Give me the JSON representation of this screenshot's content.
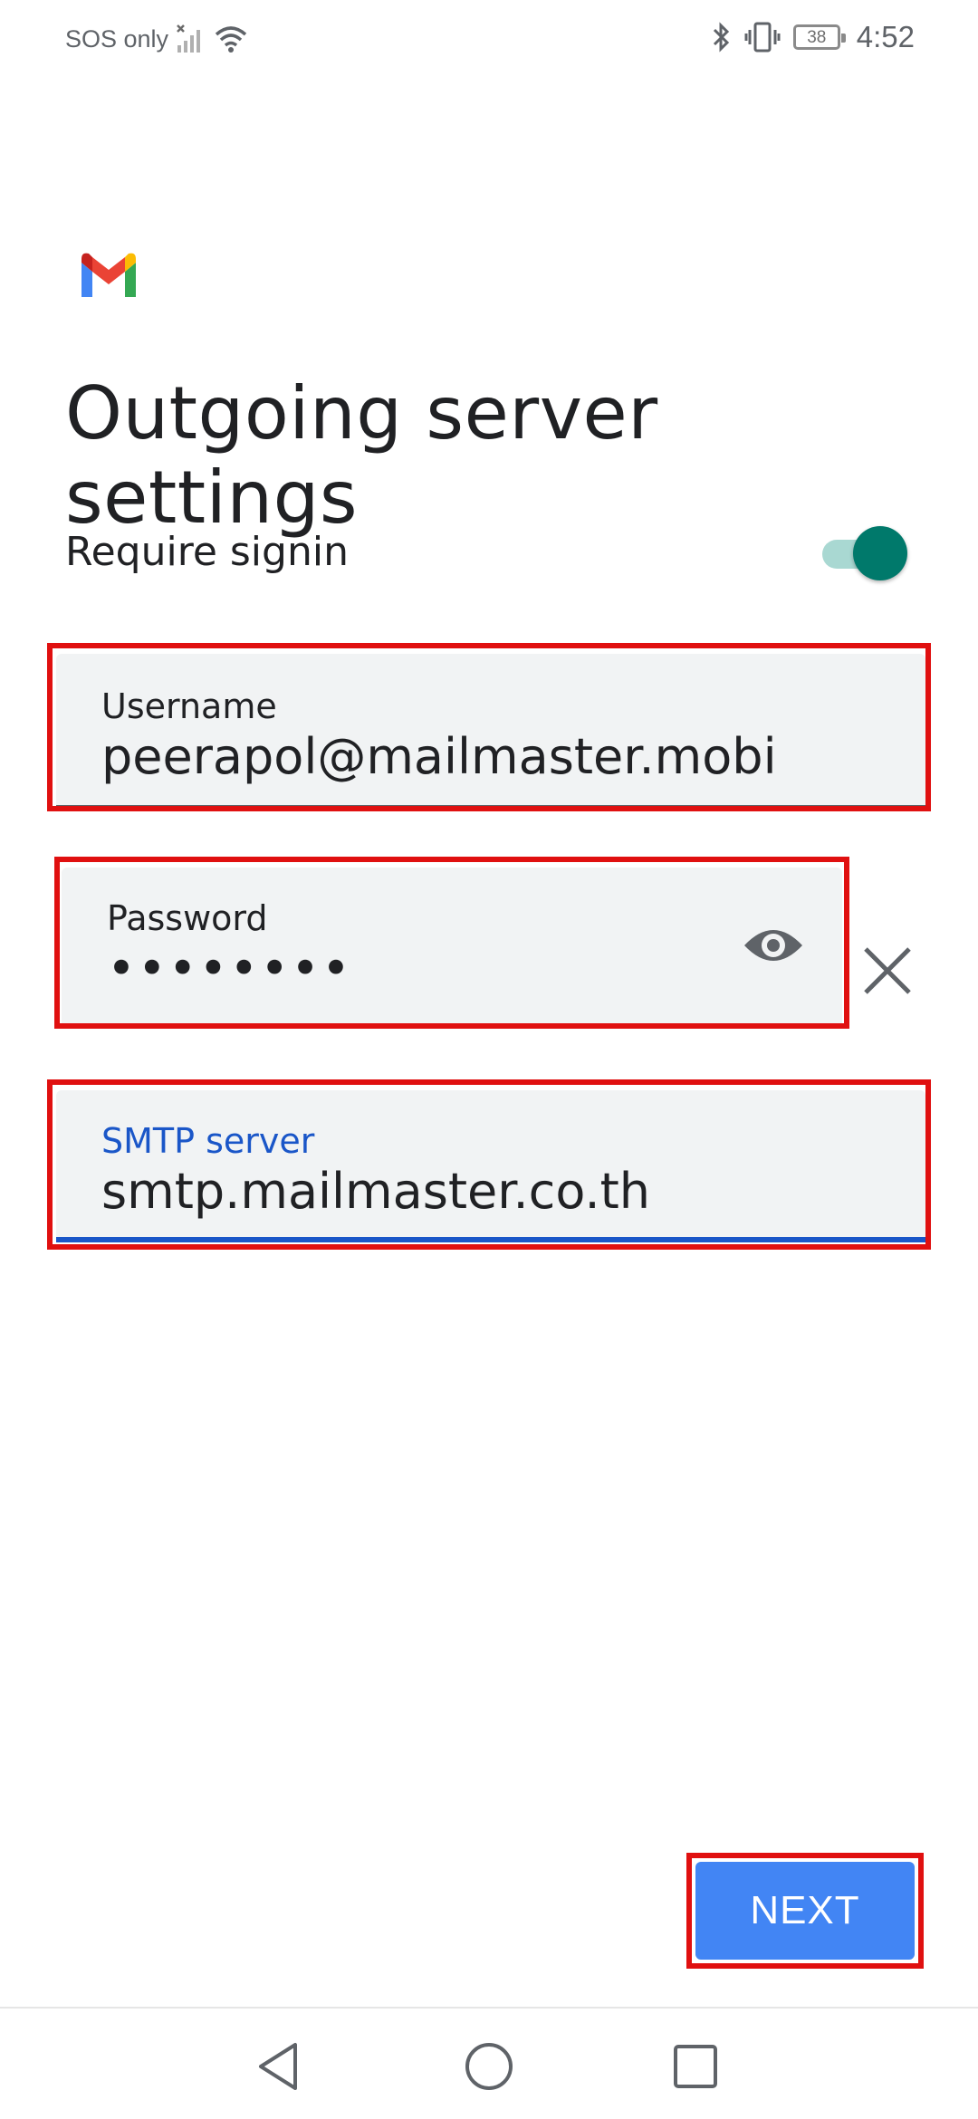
{
  "status_bar": {
    "carrier": "SOS only",
    "battery": "38",
    "time": "4:52",
    "icons": [
      "signal-icon",
      "wifi-icon",
      "bluetooth-icon",
      "vibrate-icon",
      "battery-icon"
    ]
  },
  "app": {
    "logo_icon": "gmail-logo-icon",
    "brand_colors": {
      "red": "#ea4335",
      "blue": "#4285f4",
      "green": "#34a853",
      "yellow": "#fbbc04"
    }
  },
  "page": {
    "title": "Outgoing server settings"
  },
  "require_signin": {
    "label": "Require signin",
    "enabled": true,
    "accent_color": "#00796b"
  },
  "fields": {
    "username": {
      "label": "Username",
      "value": "peerapol@mailmaster.mobi"
    },
    "password": {
      "label": "Password",
      "value": "••••••••",
      "toggle_icon": "eye-icon",
      "clear_icon": "close-icon"
    },
    "smtp": {
      "label": "SMTP server",
      "value": "smtp.mailmaster.co.th",
      "focused": true,
      "label_color": "#1a56c8"
    }
  },
  "actions": {
    "next_label": "NEXT",
    "next_color": "#4285f4"
  },
  "highlight_color": "#e01010",
  "nav_bar": {
    "icons": [
      "back-icon",
      "home-icon",
      "recent-apps-icon"
    ]
  }
}
